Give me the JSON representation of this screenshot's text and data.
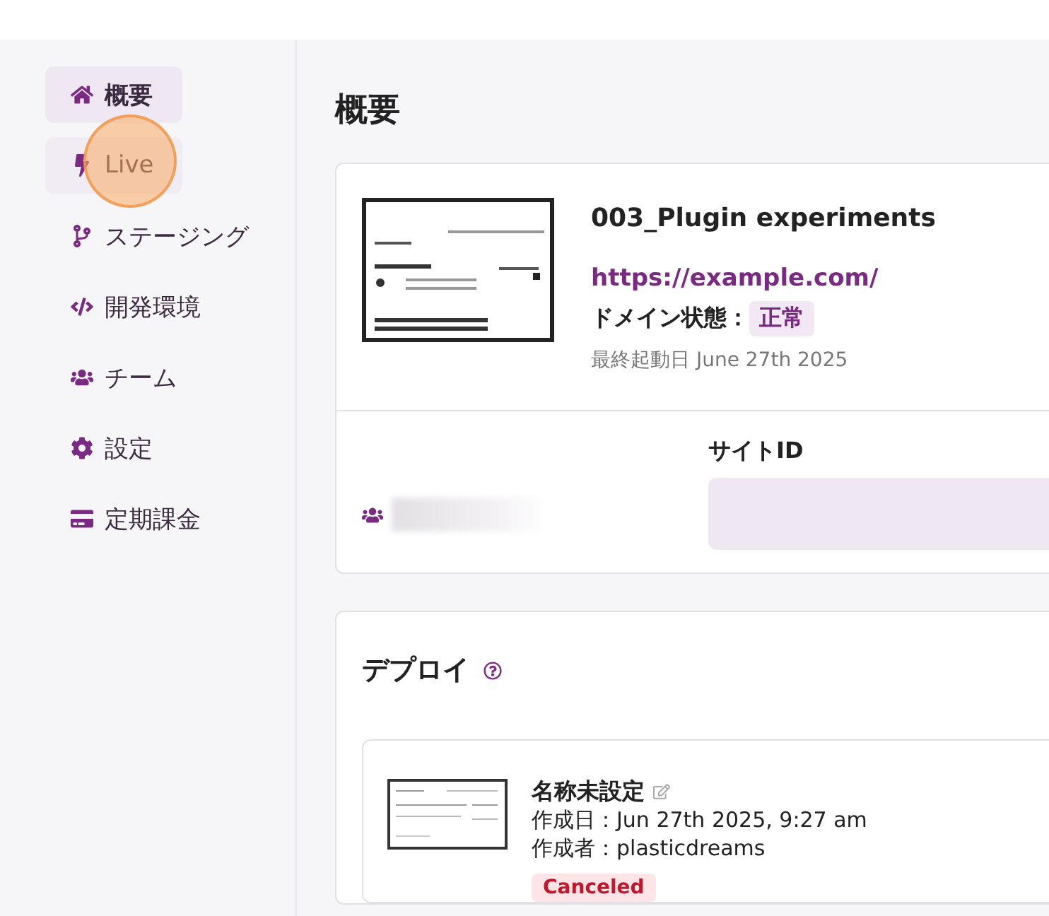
{
  "sidebar": {
    "items": [
      {
        "label": "概要",
        "selected": true,
        "hovered": false,
        "touched": false
      },
      {
        "label": "Live",
        "selected": false,
        "hovered": true,
        "touched": true
      },
      {
        "label": "ステージング",
        "selected": false,
        "hovered": false,
        "touched": false
      },
      {
        "label": "開発環境",
        "selected": false,
        "hovered": false,
        "touched": false
      },
      {
        "label": "チーム",
        "selected": false,
        "hovered": false,
        "touched": false
      },
      {
        "label": "設定",
        "selected": false,
        "hovered": false,
        "touched": false
      },
      {
        "label": "定期課金",
        "selected": false,
        "hovered": false,
        "touched": false
      }
    ]
  },
  "page_title": "概要",
  "site": {
    "name": "003_Plugin experiments",
    "url": "https://example.com/",
    "domain_label": "ドメイン状態：",
    "domain_status": "正常",
    "last_started": "最終起動日 June 27th 2025",
    "site_id_label": "サイトID"
  },
  "deploy": {
    "title": "デプロイ",
    "items": [
      {
        "name": "名称未設定",
        "created": "作成日：Jun 27th 2025, 9:27 am",
        "author": "作成者：plasticdreams",
        "status": "Canceled"
      }
    ]
  }
}
